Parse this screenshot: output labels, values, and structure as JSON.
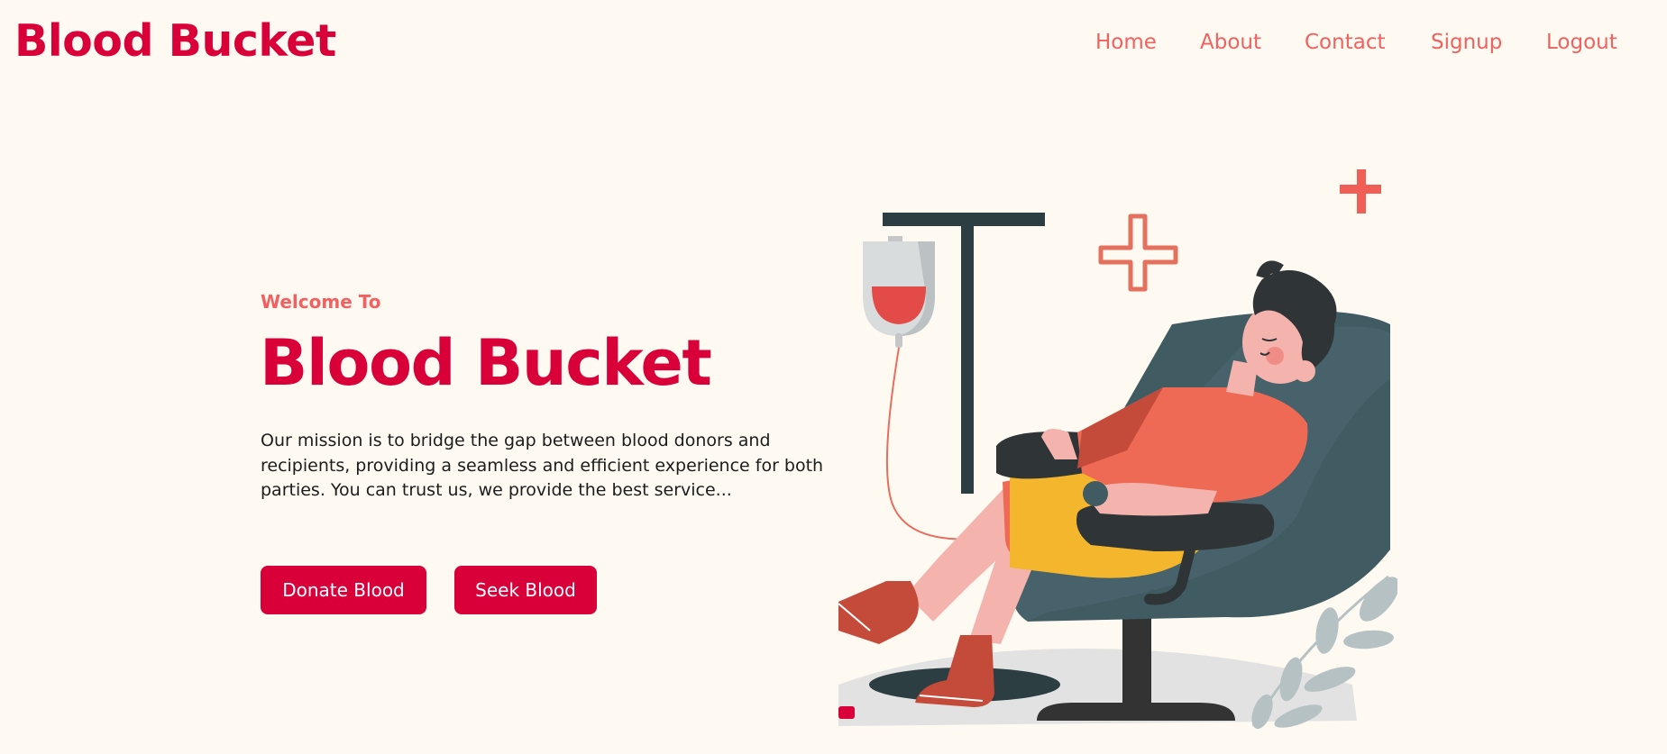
{
  "header": {
    "logo": "Blood Bucket",
    "nav": [
      {
        "label": "Home"
      },
      {
        "label": "About"
      },
      {
        "label": "Contact"
      },
      {
        "label": "Signup"
      },
      {
        "label": "Logout"
      }
    ]
  },
  "hero": {
    "subtitle": "Welcome To",
    "title": "Blood Bucket",
    "description": "Our mission is to bridge the gap between blood donors and recipients, providing a seamless and efficient experience for both parties. You can trust us, we provide the best service...",
    "buttons": {
      "donate": "Donate Blood",
      "seek": "Seek Blood"
    }
  },
  "illustration": {
    "icon": "blood-donation-illustration-icon",
    "colors": {
      "brand": "#d9003a",
      "accent": "#f06160",
      "chair": "#415b63",
      "pole": "#2d3e42",
      "shirt": "#ef6a55",
      "cushion": "#f4b62c",
      "background": "#fefaf2"
    }
  }
}
